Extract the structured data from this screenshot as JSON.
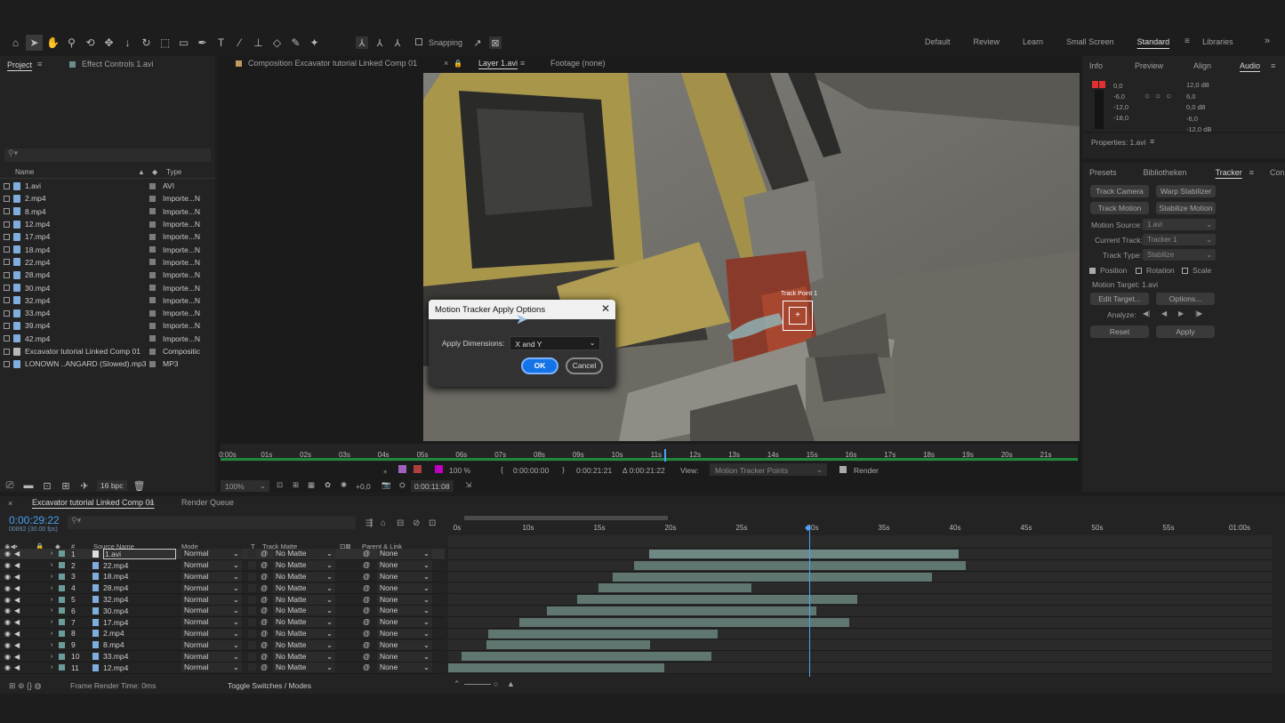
{
  "toolbar": {
    "snapping": "Snapping",
    "workspaces": [
      "Default",
      "Review",
      "Learn",
      "Small Screen",
      "Standard",
      "Libraries"
    ],
    "active_workspace": "Standard"
  },
  "project": {
    "tab": "Project",
    "effect_controls": "Effect Controls 1.avi",
    "col_name": "Name",
    "col_type": "Type",
    "bpc": "16 bpc",
    "files": [
      {
        "name": "1.avi",
        "type": "AVI",
        "kind": "video"
      },
      {
        "name": "2.mp4",
        "type": "Importe...N",
        "kind": "video"
      },
      {
        "name": "8.mp4",
        "type": "Importe...N",
        "kind": "video"
      },
      {
        "name": "12.mp4",
        "type": "Importe...N",
        "kind": "video"
      },
      {
        "name": "17.mp4",
        "type": "Importe...N",
        "kind": "video"
      },
      {
        "name": "18.mp4",
        "type": "Importe...N",
        "kind": "video"
      },
      {
        "name": "22.mp4",
        "type": "Importe...N",
        "kind": "video"
      },
      {
        "name": "28.mp4",
        "type": "Importe...N",
        "kind": "video"
      },
      {
        "name": "30.mp4",
        "type": "Importe...N",
        "kind": "video"
      },
      {
        "name": "32.mp4",
        "type": "Importe...N",
        "kind": "video"
      },
      {
        "name": "33.mp4",
        "type": "Importe...N",
        "kind": "video"
      },
      {
        "name": "39.mp4",
        "type": "Importe...N",
        "kind": "video"
      },
      {
        "name": "42.mp4",
        "type": "Importe...N",
        "kind": "video"
      },
      {
        "name": "Excavator tutorial Linked Comp 01",
        "type": "Compositic",
        "kind": "comp"
      },
      {
        "name": "LONOWN ..ANGARD (Slowed).mp3",
        "type": "MP3",
        "kind": "audio"
      }
    ]
  },
  "viewer": {
    "comp_tab": "Composition Excavator tutorial Linked Comp 01",
    "layer_tab": "Layer 1.avi",
    "footage_tab": "Footage (none)",
    "track_point": "Track Point 1",
    "ruler": [
      "0:00s",
      "01s",
      "02s",
      "03s",
      "04s",
      "05s",
      "06s",
      "07s",
      "08s",
      "09s",
      "10s",
      "11s",
      "12s",
      "13s",
      "14s",
      "15s",
      "16s",
      "17s",
      "18s",
      "19s",
      "20s",
      "21s"
    ],
    "zoom_small": "100 %",
    "in_time": "0:00:00:00",
    "out_time": "0:00:21:21",
    "duration": "Δ 0:00:21:22",
    "view_label": "View:",
    "view_value": "Motion Tracker Points",
    "render": "Render",
    "zoom": "100%",
    "exposure": "+0,0",
    "current_time": "0:00:11:08"
  },
  "dialog": {
    "title": "Motion Tracker Apply Options",
    "label": "Apply Dimensions:",
    "value": "X and Y",
    "ok": "OK",
    "cancel": "Cancel"
  },
  "right": {
    "tabs": [
      "Info",
      "Preview",
      "Align",
      "Audio"
    ],
    "active": "Audio",
    "audio_left": [
      "0,0",
      "-6,0",
      "-12,0",
      "-18,0"
    ],
    "audio_right": [
      "12,0 dB",
      "6,0",
      "0,0 dB",
      "-6,0",
      "-12,0 dB"
    ],
    "properties": "Properties: 1.avi",
    "tabs2": [
      "Presets",
      "Bibliotheken",
      "Tracker",
      "Con"
    ],
    "active2": "Tracker",
    "btn_track_camera": "Track Camera",
    "btn_warp": "Warp Stabilizer",
    "btn_track_motion": "Track Motion",
    "btn_stabilize": "Stabilize Motion",
    "motion_source_label": "Motion Source:",
    "motion_source": "1.avi",
    "current_track_label": "Current Track:",
    "current_track": "Tracker 1",
    "track_type_label": "Track Type:",
    "track_type": "Stabilize",
    "position": "Position",
    "rotation": "Rotation",
    "scale": "Scale",
    "motion_target": "Motion Target: 1.avi",
    "edit_target": "Edit Target...",
    "options": "Options...",
    "analyze": "Analyze:",
    "reset": "Reset",
    "apply": "Apply"
  },
  "timeline": {
    "tab": "Excavator tutorial Linked Comp 01",
    "render_queue": "Render Queue",
    "time": "0:00:29:22",
    "fps": "00892 (30.00 fps)",
    "col_source": "Source Name",
    "col_mode": "Mode",
    "col_t": "T",
    "col_matte": "Track Matte",
    "col_parent": "Parent & Link",
    "ruler": [
      "0s",
      "10s",
      "15s",
      "20s",
      "25s",
      "30s",
      "35s",
      "40s",
      "45s",
      "50s",
      "55s",
      "01:00s"
    ],
    "footer_render": "Frame Render Time: 0ms",
    "footer_toggle": "Toggle Switches / Modes",
    "layers": [
      {
        "n": "1",
        "name": "1.avi",
        "mode": "Normal",
        "matte": "No Matte",
        "parent": "None",
        "start": 0.244,
        "end": 0.62
      },
      {
        "n": "2",
        "name": "22.mp4",
        "mode": "Normal",
        "matte": "No Matte",
        "parent": "None",
        "start": 0.226,
        "end": 0.628
      },
      {
        "n": "3",
        "name": "18.mp4",
        "mode": "Normal",
        "matte": "No Matte",
        "parent": "None",
        "start": 0.2,
        "end": 0.587
      },
      {
        "n": "4",
        "name": "28.mp4",
        "mode": "Normal",
        "matte": "No Matte",
        "parent": "None",
        "start": 0.183,
        "end": 0.368
      },
      {
        "n": "5",
        "name": "32.mp4",
        "mode": "Normal",
        "matte": "No Matte",
        "parent": "None",
        "start": 0.157,
        "end": 0.497
      },
      {
        "n": "6",
        "name": "30.mp4",
        "mode": "Normal",
        "matte": "No Matte",
        "parent": "None",
        "start": 0.12,
        "end": 0.447
      },
      {
        "n": "7",
        "name": "17.mp4",
        "mode": "Normal",
        "matte": "No Matte",
        "parent": "None",
        "start": 0.086,
        "end": 0.487
      },
      {
        "n": "8",
        "name": "2.mp4",
        "mode": "Normal",
        "matte": "No Matte",
        "parent": "None",
        "start": 0.049,
        "end": 0.327
      },
      {
        "n": "9",
        "name": "8.mp4",
        "mode": "Normal",
        "matte": "No Matte",
        "parent": "None",
        "start": 0.046,
        "end": 0.245
      },
      {
        "n": "10",
        "name": "33.mp4",
        "mode": "Normal",
        "matte": "No Matte",
        "parent": "None",
        "start": 0.016,
        "end": 0.32
      },
      {
        "n": "11",
        "name": "12.mp4",
        "mode": "Normal",
        "matte": "No Matte",
        "parent": "None",
        "start": 0.0,
        "end": 0.262
      }
    ]
  }
}
